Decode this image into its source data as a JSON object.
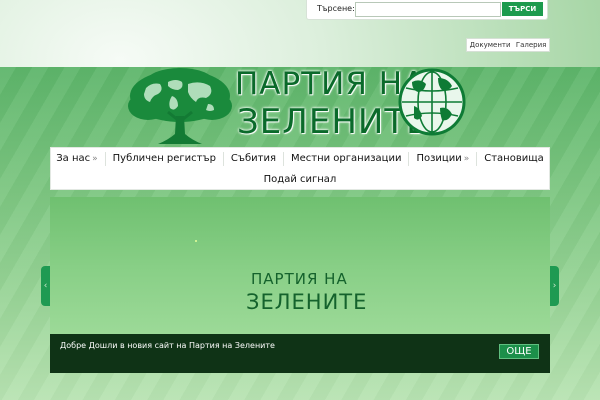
{
  "search": {
    "label": "Търсене:",
    "placeholder": "",
    "value": "",
    "button_label": "ТЪРСИ"
  },
  "top_links": [
    {
      "label": "Документи"
    },
    {
      "label": "Галерия"
    }
  ],
  "logo": {
    "line1": "ПАРТИЯ НА",
    "line2": "ЗЕЛЕНИТЕ"
  },
  "nav": {
    "items": [
      {
        "label": "За нас",
        "has_submenu": "»"
      },
      {
        "label": "Публичен регистър"
      },
      {
        "label": "Събития"
      },
      {
        "label": "Местни организации"
      },
      {
        "label": "Позиции",
        "has_submenu": "»"
      },
      {
        "label": "Становища"
      },
      {
        "label": "Подай сигнал"
      }
    ]
  },
  "slider": {
    "logo_line1": "ПАРТИЯ НА",
    "logo_line2": "ЗЕЛЕНИТЕ",
    "caption": "Добре Дошли в новия сайт на Партия на Зелените",
    "more_label": "ОЩЕ",
    "prev_glyph": "‹",
    "next_glyph": "›"
  },
  "colors": {
    "brand_green": "#0a6a2a",
    "button_green": "#1d9b4e",
    "caption_bg": "#0f3316"
  },
  "icons": {
    "logo_tree": "tree-world-map-icon",
    "logo_globe": "globe-icon"
  }
}
